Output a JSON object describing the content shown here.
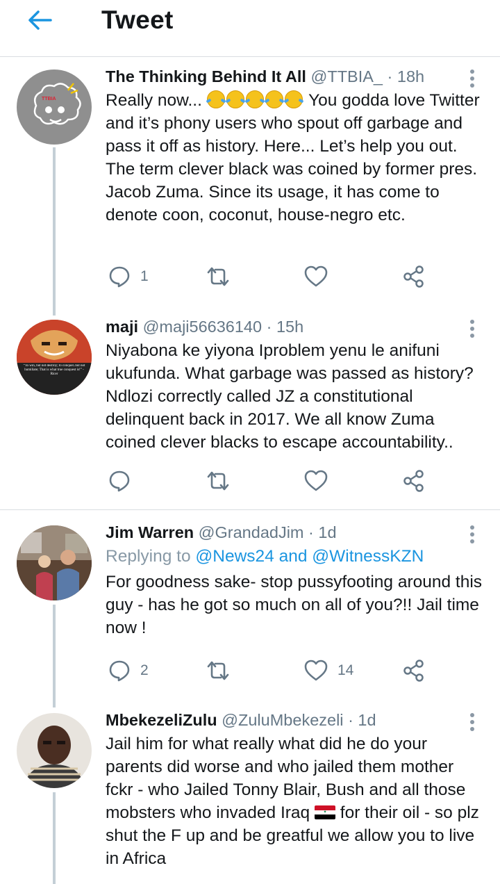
{
  "header": {
    "title": "Tweet"
  },
  "colors": {
    "accent": "#1b95e0",
    "muted": "#657786",
    "thread": "#c4cfd6"
  },
  "tweets": [
    {
      "name": "The Thinking Behind It All",
      "handle": "@TTBIA_",
      "sep": "·",
      "time": "18h",
      "text_before": "Really now...",
      "emoji_count": 5,
      "text_after": " You godda love Twitter and it’s phony users who spout off garbage and pass it off as history. Here... Let’s help you out. The term clever black was coined by former pres. Jacob Zuma. Since its usage, it has come to denote coon, coconut, house-negro etc.",
      "avatar_label": "TTBIA",
      "replies": "1",
      "retweets": "",
      "likes": ""
    },
    {
      "name": "maji",
      "handle": "@maji56636140",
      "sep": "·",
      "time": "15h",
      "text": "Niyabona ke yiyona Iproblem yenu le anifuni ukufunda. What garbage was passed as history? Ndlozi correctly called JZ a constitutional delinquent back in 2017. We all know Zuma coined clever blacks to escape accountability..",
      "avatar_quote": "“To win, but not destroy; to conquer..but not humiliate; That is what true conquest is!” - Ricer",
      "replies": "",
      "retweets": "",
      "likes": ""
    },
    {
      "name": "Jim Warren",
      "handle": "@GrandadJim",
      "sep": "·",
      "time": "1d",
      "replying_prefix": "Replying to ",
      "replying_to": "@News24 and @WitnessKZN",
      "text": "For goodness sake- stop pussyfooting around this guy - has he got so much on all of you?!! Jail time now !",
      "replies": "2",
      "retweets": "",
      "likes": "14"
    },
    {
      "name": "MbekezeliZulu",
      "handle": "@ZuluMbekezeli",
      "sep": "·",
      "time": "1d",
      "text_before": "Jail him for what really what did he do your parents did worse and who jailed them mother fckr - who Jailed Tonny Blair, Bush and all those mobsters who invaded Iraq",
      "text_after": " for their oil - so plz shut the F up and be greatful we allow you to live in Africa",
      "flag_name": "iraq-flag"
    }
  ]
}
